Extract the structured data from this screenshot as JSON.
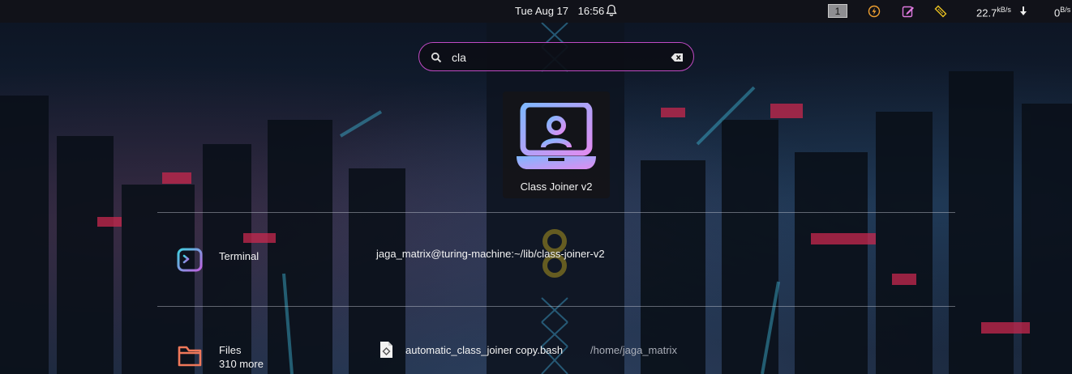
{
  "topbar": {
    "date": "Tue Aug 17",
    "time": "16:56",
    "workspace": "1",
    "down_rate": "22.7",
    "down_unit": "kB/s",
    "up_rate": "0",
    "up_unit": "B/s",
    "icons": [
      "bell-icon",
      "power-icon",
      "notes-icon",
      "ruler-icon",
      "download-arrow-icon"
    ]
  },
  "search": {
    "query": "cla",
    "placeholder": ""
  },
  "top_result": {
    "name": "Class Joiner v2",
    "icon": "laptop-user-icon"
  },
  "results": [
    {
      "category": "Terminal",
      "category_icon": "terminal-icon",
      "item": "jaga_matrix@turing-machine:~/lib/class-joiner-v2"
    },
    {
      "category": "Files",
      "category_icon": "folder-icon",
      "more": "310 more",
      "item": "automatic_class_joiner copy.bash",
      "item_icon": "script-file-icon",
      "path": "/home/jaga_matrix"
    }
  ],
  "colors": {
    "accent": "#c04ac4",
    "topbar_bg": "#111219",
    "gradient_start": "#7fb8ff",
    "gradient_end": "#e08cf0",
    "folder": "#f0785a"
  }
}
